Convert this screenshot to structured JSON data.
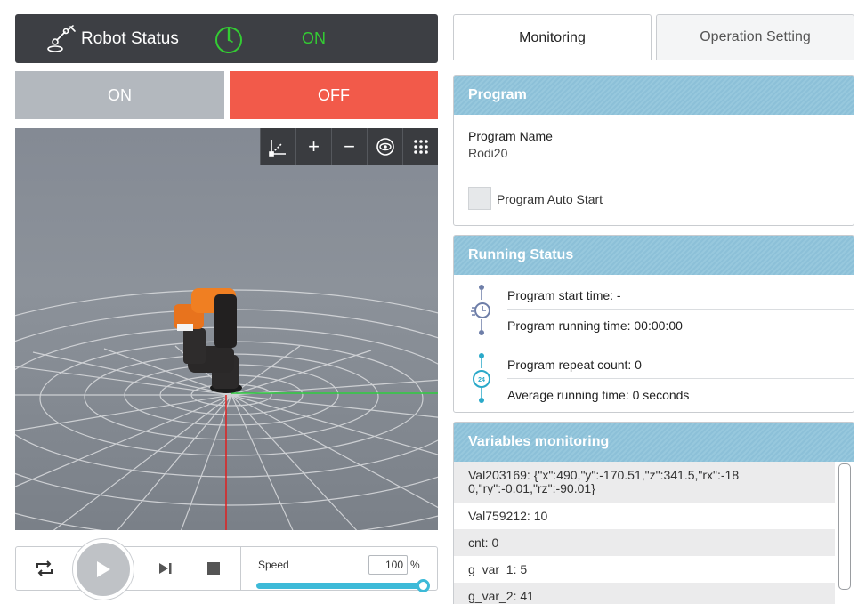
{
  "status": {
    "title": "Robot Status",
    "state": "ON",
    "state_color": "#33cc33",
    "robot_icon": "robot-arm-icon",
    "power_icon": "power-icon"
  },
  "power": {
    "on_label": "ON",
    "off_label": "OFF"
  },
  "viewport_toolbar": [
    "axis-icon",
    "zoom-in-icon",
    "zoom-out-icon",
    "eye-icon",
    "grid-dots-icon"
  ],
  "player": {
    "speed_label": "Speed",
    "speed_value": "100",
    "speed_unit": "%",
    "speed_fraction": 1.0
  },
  "tabs": [
    {
      "label": "Monitoring",
      "active": true
    },
    {
      "label": "Operation Setting",
      "active": false
    }
  ],
  "program": {
    "header": "Program",
    "name_label": "Program Name",
    "name_value": "Rodi20",
    "auto_start_label": "Program Auto Start"
  },
  "running": {
    "header": "Running Status",
    "start_time": "Program start time: -",
    "running_time": "Program running time:  00:00:00",
    "repeat_count": "Program repeat count: 0",
    "average_time": "Average running time: 0 seconds"
  },
  "variables": {
    "header": "Variables monitoring",
    "items": [
      "Val203169: {\"x\":490,\"y\":-170.51,\"z\":341.5,\"rx\":-18",
      "0,\"ry\":-0.01,\"rz\":-90.01}",
      "Val759212: 10",
      "cnt: 0",
      "g_var_1: 5",
      "g_var_2: 41"
    ]
  },
  "colors": {
    "accent": "#3dbad8",
    "off_button": "#f25a4a",
    "on_button": "#b3b8be",
    "header_bg": "#8cc0d8"
  }
}
